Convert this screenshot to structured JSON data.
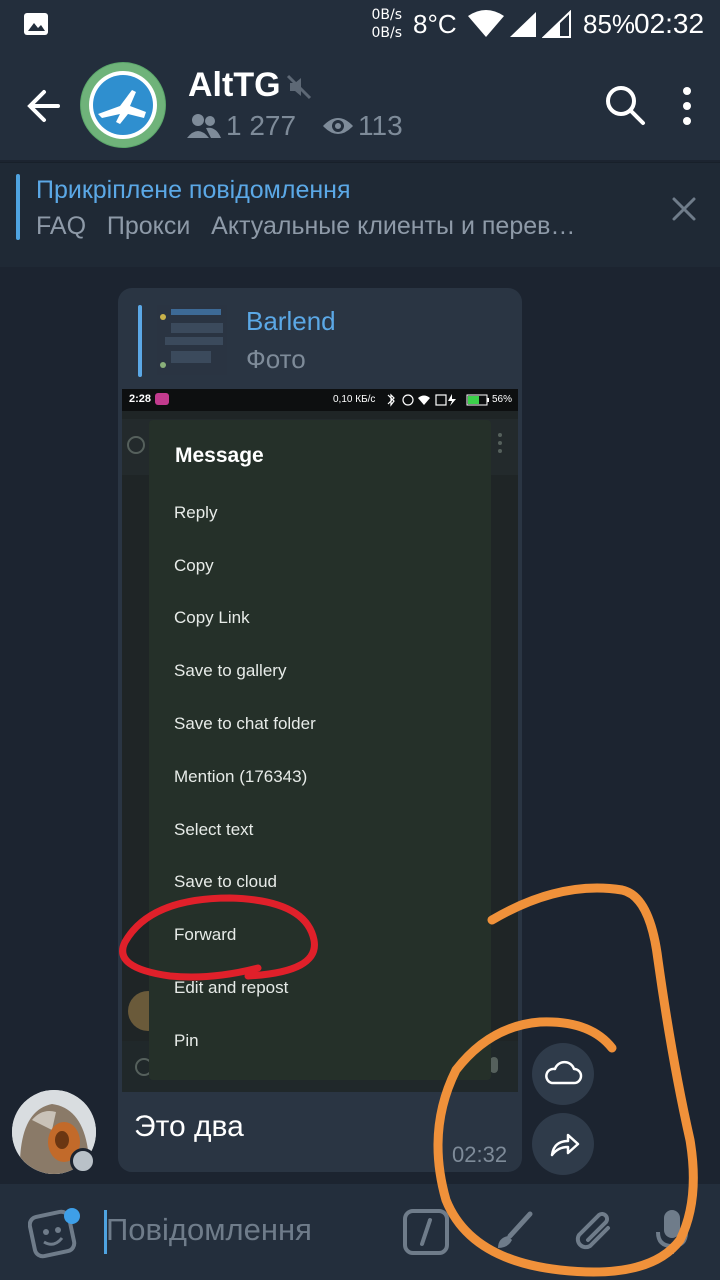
{
  "status_bar": {
    "net_up": "0B/s",
    "net_down": "0B/s",
    "temperature": "8°C",
    "battery": "85%",
    "time": "02:32"
  },
  "header": {
    "title": "AltTG",
    "members": "1 277",
    "views": "113"
  },
  "pinned": {
    "title": "Прикріплене повідомлення",
    "text": "FAQ   Прокси   Актуальные клиенты и перев…"
  },
  "message": {
    "reply_name": "Barlend",
    "reply_type": "Фото",
    "text": "Это два",
    "time": "02:32"
  },
  "screenshot": {
    "status_time": "2:28",
    "status_speed": "0,10 КБ/с",
    "status_battery": "56%",
    "menu_title": "Message",
    "menu_items": [
      "Reply",
      "Copy",
      "Copy Link",
      "Save to gallery",
      "Save to chat folder",
      "Mention (176343)",
      "Select text",
      "Save to cloud",
      "Forward",
      "Edit and repost",
      "Pin"
    ]
  },
  "composer": {
    "placeholder": "Повідомлення"
  },
  "colors": {
    "accent": "#5ba8e6",
    "background": "#1c2430",
    "panel": "#232e3c",
    "annotation_red": "#e0202a",
    "annotation_orange": "#f0913a"
  }
}
